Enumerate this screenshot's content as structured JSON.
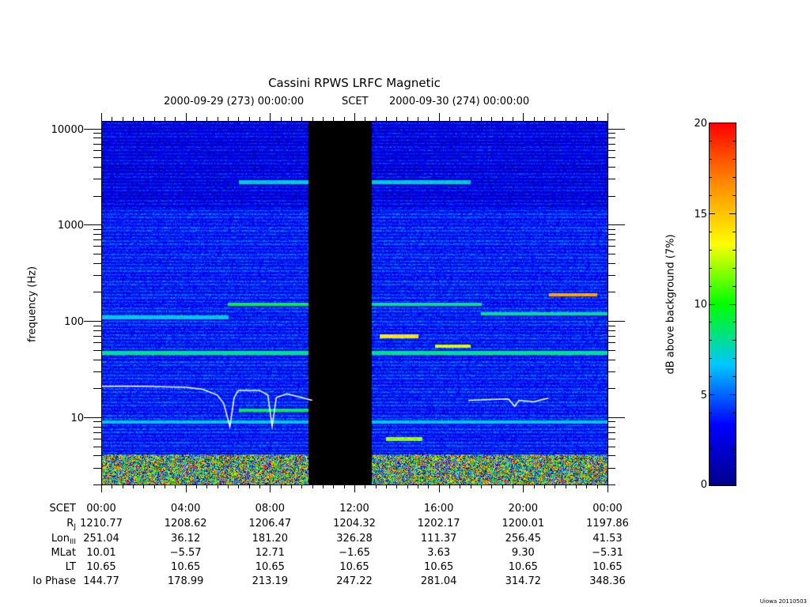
{
  "chart_data": {
    "type": "heatmap",
    "title": "Cassini RPWS LRFC Magnetic",
    "subtitle_start": "2000-09-29 (273) 00:00:00",
    "subtitle_mid": "SCET",
    "subtitle_end": "2000-09-30 (274) 00:00:00",
    "ylabel": "frequency (Hz)",
    "y_scale": "log",
    "ylim": [
      2,
      12000
    ],
    "y_ticks": [
      {
        "value": 10,
        "label": "10"
      },
      {
        "value": 100,
        "label": "100"
      },
      {
        "value": 1000,
        "label": "1000"
      },
      {
        "value": 10000,
        "label": "10000"
      }
    ],
    "xlim_hours": [
      0,
      24
    ],
    "colorbar": {
      "label": "dB above background (7%)",
      "range": [
        0,
        20
      ],
      "ticks": [
        "0",
        "5",
        "10",
        "15",
        "20"
      ],
      "colors": [
        "#00008b",
        "#0000ff",
        "#00c8ff",
        "#00ff00",
        "#ffff00",
        "#ff8c00",
        "#ff0000"
      ]
    },
    "data_gap_hours": [
      9.8,
      12.8
    ],
    "bands": [
      {
        "f": 190,
        "start": 21.2,
        "end": 23.5,
        "level": 16
      },
      {
        "f": 70,
        "start": 13.2,
        "end": 15.0,
        "level": 14
      },
      {
        "f": 55,
        "start": 15.8,
        "end": 17.5,
        "level": 13
      },
      {
        "f": 150,
        "start": 6.0,
        "end": 9.8,
        "level": 9
      },
      {
        "f": 150,
        "start": 12.8,
        "end": 18.0,
        "level": 8
      },
      {
        "f": 47,
        "start": 0,
        "end": 24,
        "level": 8
      },
      {
        "f": 9,
        "start": 0,
        "end": 24,
        "level": 7
      },
      {
        "f": 12,
        "start": 6.5,
        "end": 9.8,
        "level": 9
      },
      {
        "f": 6,
        "start": 13.5,
        "end": 15.2,
        "level": 12
      },
      {
        "f": 2800,
        "start": 6.5,
        "end": 17.5,
        "level": 7
      },
      {
        "f": 110,
        "start": 0,
        "end": 6.0,
        "level": 7
      },
      {
        "f": 120,
        "start": 18.0,
        "end": 24,
        "level": 8
      }
    ],
    "trace_white": [
      {
        "segment": 1,
        "points": [
          [
            0,
            21
          ],
          [
            2,
            21
          ],
          [
            4,
            20.5
          ],
          [
            4.8,
            19.5
          ],
          [
            5.5,
            17
          ],
          [
            5.8,
            14
          ],
          [
            6.1,
            8
          ],
          [
            6.3,
            16
          ],
          [
            6.5,
            19
          ],
          [
            7.5,
            19
          ],
          [
            7.9,
            17
          ],
          [
            8.1,
            8
          ],
          [
            8.3,
            16
          ],
          [
            8.8,
            17.5
          ],
          [
            9.5,
            16
          ],
          [
            10.0,
            15
          ]
        ]
      },
      {
        "segment": 2,
        "points": [
          [
            17.4,
            15
          ],
          [
            19.3,
            15.5
          ],
          [
            19.6,
            13
          ],
          [
            19.8,
            15
          ],
          [
            20.5,
            14.5
          ],
          [
            21.2,
            15.8
          ]
        ]
      }
    ]
  },
  "ephemeris": {
    "rows": [
      {
        "label": "SCET",
        "label_sub": "",
        "values": [
          "00:00",
          "04:00",
          "08:00",
          "12:00",
          "16:00",
          "20:00",
          "00:00"
        ]
      },
      {
        "label": "R",
        "label_sub": "J",
        "values": [
          "1210.77",
          "1208.62",
          "1206.47",
          "1204.32",
          "1202.17",
          "1200.01",
          "1197.86"
        ]
      },
      {
        "label": "Lon",
        "label_sub": "III",
        "values": [
          "251.04",
          "36.12",
          "181.20",
          "326.28",
          "111.37",
          "256.45",
          "41.53"
        ]
      },
      {
        "label": "MLat",
        "label_sub": "",
        "values": [
          "10.01",
          "−5.57",
          "12.71",
          "−1.65",
          "3.63",
          "9.30",
          "−5.31"
        ]
      },
      {
        "label": "LT",
        "label_sub": "",
        "values": [
          "10.65",
          "10.65",
          "10.65",
          "10.65",
          "10.65",
          "10.65",
          "10.65"
        ]
      },
      {
        "label": "Io Phase",
        "label_sub": "",
        "values": [
          "144.77",
          "178.99",
          "213.19",
          "247.22",
          "281.04",
          "314.72",
          "348.36"
        ]
      }
    ]
  },
  "credit": "Uiowa 20110503"
}
